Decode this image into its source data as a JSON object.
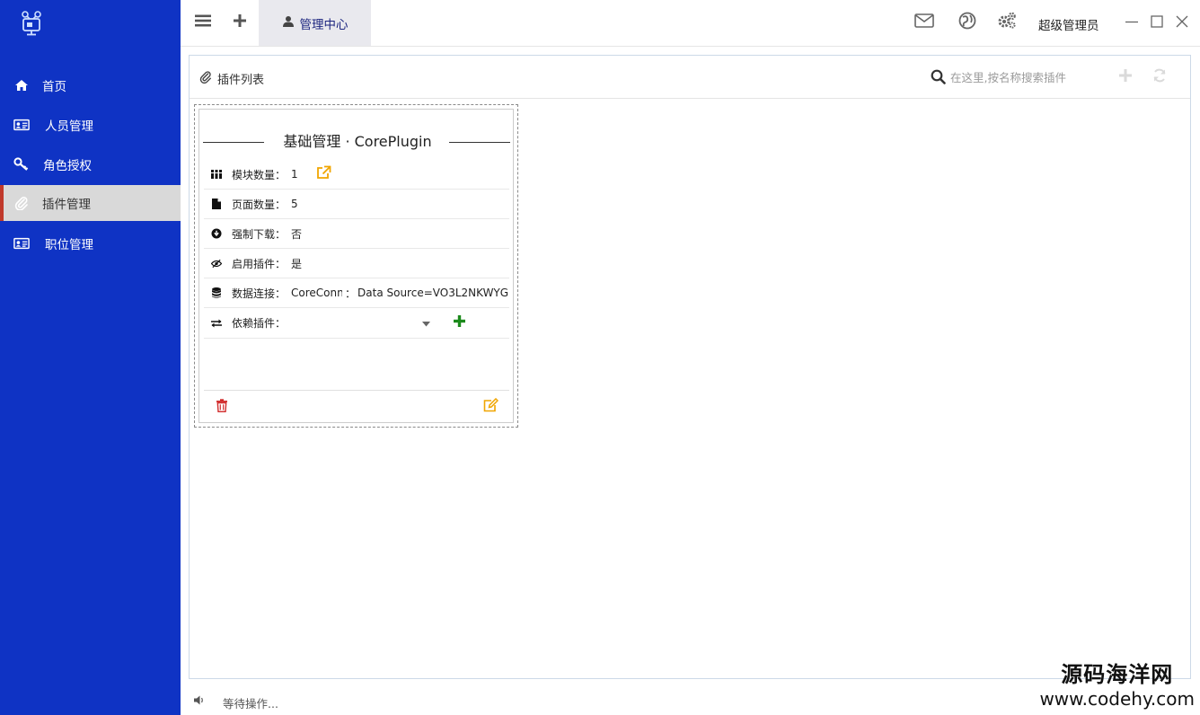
{
  "sidebar": {
    "items": [
      {
        "label": "首页",
        "icon": "home-icon"
      },
      {
        "label": "人员管理",
        "icon": "id-card-icon"
      },
      {
        "label": "角色授权",
        "icon": "key-icon"
      },
      {
        "label": "插件管理",
        "icon": "paperclip-icon",
        "active": true
      },
      {
        "label": "职位管理",
        "icon": "id-card-icon"
      }
    ],
    "bg_color": "#0f33c4",
    "active_bg": "#d9d9d9"
  },
  "topbar": {
    "tab_label": "管理中心",
    "user_name": "超级管理员"
  },
  "content": {
    "title": "插件列表",
    "search_placeholder": "在这里,按名称搜索插件"
  },
  "card": {
    "title": "基础管理 · CorePlugin",
    "rows": [
      {
        "label": "模块数量：",
        "value": "1",
        "icon": "grid-icon"
      },
      {
        "label": "页面数量：",
        "value": "5",
        "icon": "file-icon"
      },
      {
        "label": "强制下载：",
        "value": "否",
        "icon": "download-circle-icon"
      },
      {
        "label": "启用插件：",
        "value": "是",
        "icon": "eye-slash-icon"
      },
      {
        "label": "数据连接：",
        "value_name": "CoreConn",
        "value_sep": "：",
        "value_conn": "Data Source=VO3L2NKWYG",
        "icon": "database-icon"
      },
      {
        "label": "依赖插件：",
        "value": "",
        "icon": "exchange-icon"
      }
    ]
  },
  "statusbar": {
    "text": "等待操作..."
  },
  "watermark": {
    "line1": "源码海洋网",
    "line2": "www.codehy.com"
  }
}
